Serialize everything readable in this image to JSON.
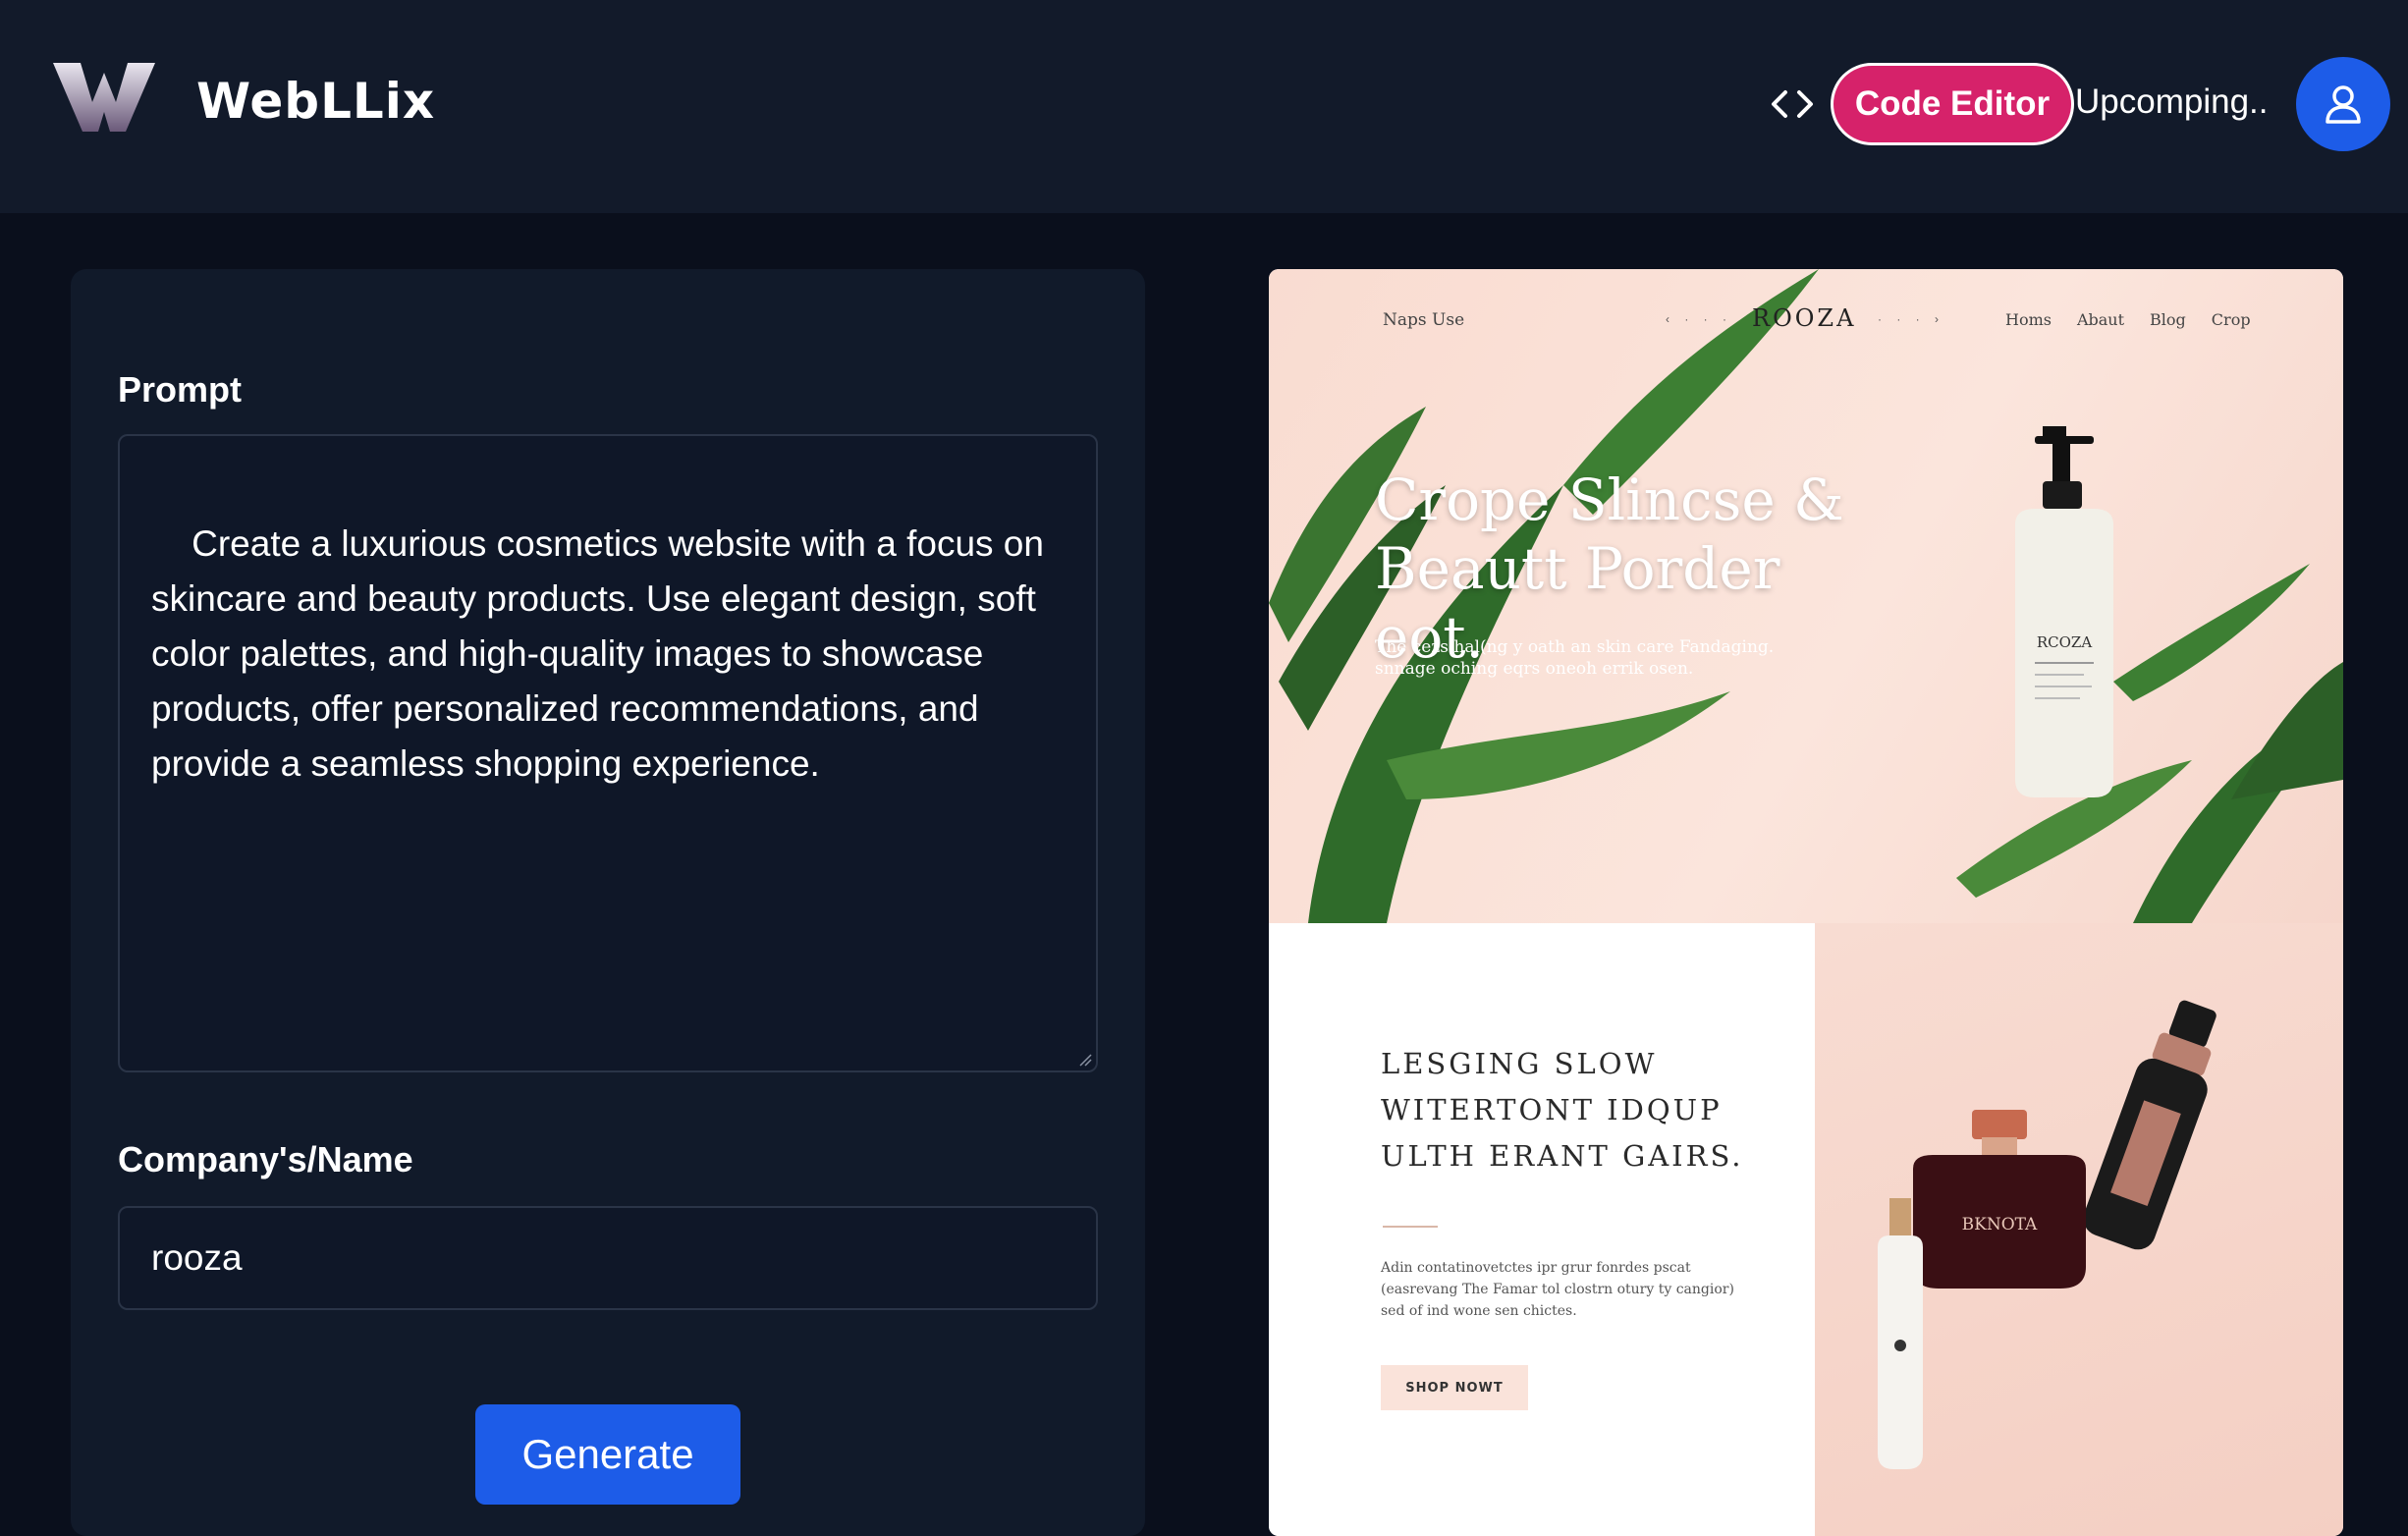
{
  "header": {
    "brand": "WebLLix",
    "code_editor_label": "Code Editor",
    "upcoming_label": "Upcomping.."
  },
  "form": {
    "prompt_label": "Prompt",
    "prompt_value": "Create a luxurious cosmetics website with a focus on skincare and beauty products. Use elegant design, soft color palettes, and high-quality images to showcase products, offer personalized recommendations, and provide a seamless shopping experience.",
    "company_label": "Company's/Name",
    "company_value": "rooza",
    "generate_label": "Generate"
  },
  "preview": {
    "nav_left": "Naps Use",
    "brand": "ROOZA",
    "nav_links": [
      "Homs",
      "Abaut",
      "Blog",
      "Crop"
    ],
    "hero_title": "Crope Slincse & Beautt Porder eot.",
    "hero_sub": "The cezs hal(ng y oath an skin care Fandaging. snnage oching eqrs oneoh errik osen.",
    "bottle_label": "RCOZA",
    "lower_title": "LESGING SLOW WITERTONT IDQUP ULTH ERANT GAIRS.",
    "lower_body": "Adin contatinovetctes ipr grur fonrdes pscat (easrevang The Famar tol clostrn otury ty cangior) sed of ind wone sen chictes.",
    "shop_label": "SHOP NOWT",
    "jar_label": "BKNOTA"
  },
  "colors": {
    "header_bg": "#121a2a",
    "page_bg": "#0a0f1c",
    "accent_pink": "#d6226a",
    "accent_blue": "#1d5ce8"
  }
}
